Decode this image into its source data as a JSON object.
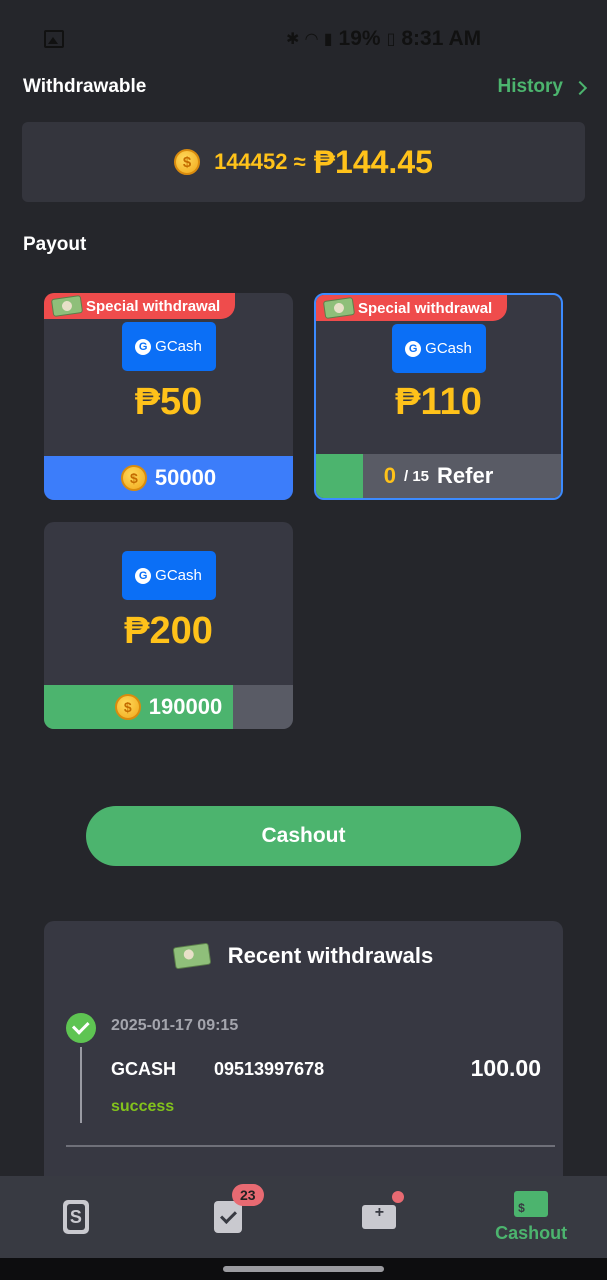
{
  "status_bar": {
    "battery": "19%",
    "time": "8:31 AM"
  },
  "header": {
    "title": "Withdrawable",
    "history_label": "History"
  },
  "balance": {
    "coin_symbol": "$",
    "coins": "144452 ≈",
    "peso": "₱144.45"
  },
  "payout": {
    "title": "Payout",
    "cards": [
      {
        "badge": "Special withdrawal",
        "provider": "GCash",
        "amount": "₱50",
        "cost": "50000",
        "selected": false
      },
      {
        "badge": "Special withdrawal",
        "provider": "GCash",
        "amount": "₱110",
        "refer_current": "0",
        "refer_total": "/ 15",
        "refer_label": "Refer",
        "progress": 0.19,
        "selected": true
      },
      {
        "provider": "GCash",
        "amount": "₱200",
        "cost": "190000",
        "progress": 0.76,
        "selected": false
      }
    ]
  },
  "cashout_button": "Cashout",
  "recent": {
    "title": "Recent withdrawals",
    "items": [
      {
        "date": "2025-01-17 09:15",
        "method": "GCASH",
        "account": "09513997678",
        "amount": "100.00",
        "status": "success"
      }
    ]
  },
  "bottom_nav": {
    "items": [
      {
        "icon": "wallet-icon",
        "label": ""
      },
      {
        "icon": "task-icon",
        "label": "",
        "badge": "23"
      },
      {
        "icon": "mail-icon",
        "label": "",
        "dot": true
      },
      {
        "icon": "cashout-icon",
        "label": "Cashout",
        "active": true
      }
    ]
  },
  "colors": {
    "background": "#25262b",
    "accent_green": "#4cb46e",
    "gold": "#ffc21a",
    "blue": "#3c7dfa",
    "red_badge": "#ef4c4c"
  }
}
